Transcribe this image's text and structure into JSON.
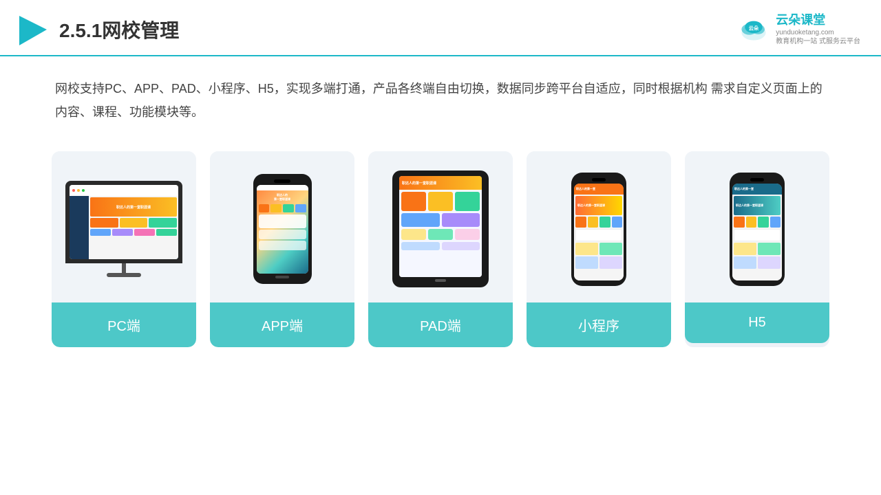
{
  "header": {
    "title": "2.5.1网校管理",
    "logo_name": "云朵课堂",
    "logo_url": "yunduoketang.com",
    "logo_tagline": "教育机构一站\n式服务云平台"
  },
  "description": "网校支持PC、APP、PAD、小程序、H5，实现多端打通，产品各终端自由切换，数据同步跨平台自适应，同时根据机构\n需求自定义页面上的内容、课程、功能模块等。",
  "cards": [
    {
      "id": "pc",
      "label": "PC端"
    },
    {
      "id": "app",
      "label": "APP端"
    },
    {
      "id": "pad",
      "label": "PAD端"
    },
    {
      "id": "miniprogram",
      "label": "小程序"
    },
    {
      "id": "h5",
      "label": "H5"
    }
  ],
  "colors": {
    "accent": "#1cb8c8",
    "card_bg": "#edf1f7",
    "label_bg": "#4dc8c8",
    "label_text": "#ffffff",
    "header_border": "#1cb8c8"
  }
}
